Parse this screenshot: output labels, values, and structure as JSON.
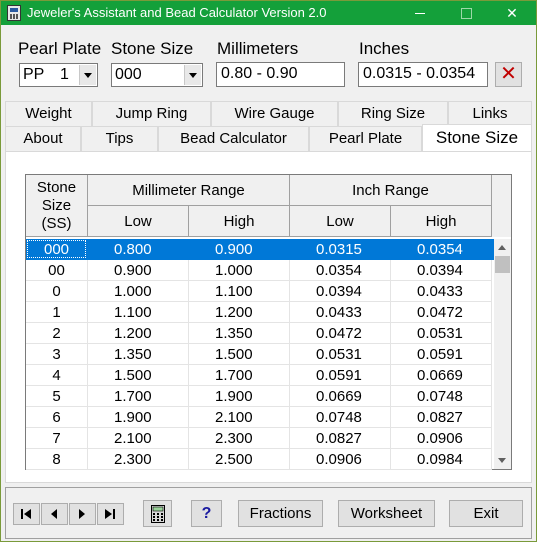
{
  "window": {
    "title": "Jeweler's Assistant and Bead Calculator Version 2.0",
    "icon": "bead-calculator-app-icon"
  },
  "titlebar_buttons": {
    "minimize": "minimize-icon",
    "maximize": "maximize-icon",
    "close": "✕"
  },
  "fields": {
    "pearl_plate": {
      "label": "Pearl Plate",
      "prefix": "PP",
      "value": "1"
    },
    "stone_size": {
      "label": "Stone Size",
      "value": "000"
    },
    "millimeters": {
      "label": "Millimeters",
      "value": "0.80 - 0.90"
    },
    "inches": {
      "label": "Inches",
      "value": "0.0315 - 0.0354"
    },
    "clear_symbol": "✕"
  },
  "tabs_back": [
    "Weight",
    "Jump Ring",
    "Wire Gauge",
    "Ring Size",
    "Links"
  ],
  "tabs_front": [
    "About",
    "Tips",
    "Bead Calculator",
    "Pearl Plate",
    "Stone Size"
  ],
  "active_tab": "Stone Size",
  "table": {
    "col_ss_line1": "Stone",
    "col_ss_line2": "Size",
    "col_ss_line3": "(SS)",
    "group_mm": "Millimeter Range",
    "group_in": "Inch Range",
    "low": "Low",
    "high": "High",
    "rows": [
      [
        "000",
        "0.800",
        "0.900",
        "0.0315",
        "0.0354"
      ],
      [
        "00",
        "0.900",
        "1.000",
        "0.0354",
        "0.0394"
      ],
      [
        "0",
        "1.000",
        "1.100",
        "0.0394",
        "0.0433"
      ],
      [
        "1",
        "1.100",
        "1.200",
        "0.0433",
        "0.0472"
      ],
      [
        "2",
        "1.200",
        "1.350",
        "0.0472",
        "0.0531"
      ],
      [
        "3",
        "1.350",
        "1.500",
        "0.0531",
        "0.0591"
      ],
      [
        "4",
        "1.500",
        "1.700",
        "0.0591",
        "0.0669"
      ],
      [
        "5",
        "1.700",
        "1.900",
        "0.0669",
        "0.0748"
      ],
      [
        "6",
        "1.900",
        "2.100",
        "0.0748",
        "0.0827"
      ],
      [
        "7",
        "2.100",
        "2.300",
        "0.0827",
        "0.0906"
      ],
      [
        "8",
        "2.300",
        "2.500",
        "0.0906",
        "0.0984"
      ]
    ],
    "selected_row": 0
  },
  "bottom": {
    "nav": [
      "first-record-icon",
      "prev-record-icon",
      "next-record-icon",
      "last-record-icon"
    ],
    "calculator_icon": "calculator-icon",
    "help": "?",
    "fractions": "Fractions",
    "worksheet": "Worksheet",
    "exit": "Exit"
  },
  "colors": {
    "titlebar": "#14a03a",
    "selection": "#0078d7",
    "clear": "#c00000",
    "help": "#1a1aa0"
  }
}
